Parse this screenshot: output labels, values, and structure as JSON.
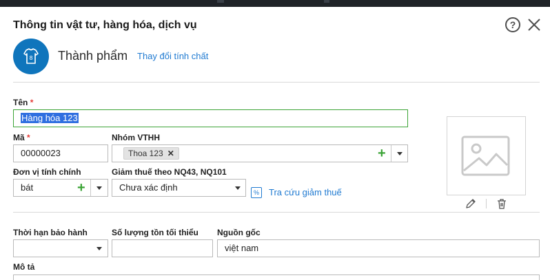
{
  "dialog": {
    "title": "Thông tin vật tư, hàng hóa, dịch vụ",
    "help_icon": "question-circle-icon",
    "close_icon": "close-icon"
  },
  "item_type": {
    "icon": "tshirt-icon",
    "label": "Thành phẩm",
    "change_link": "Thay đổi tính chất"
  },
  "form": {
    "name": {
      "label": "Tên",
      "required_mark": "*",
      "value": "Hàng hóa 123"
    },
    "code": {
      "label": "Mã",
      "required_mark": "*",
      "value": "00000023"
    },
    "group": {
      "label": "Nhóm VTHH",
      "tags": [
        "Thoa 123"
      ],
      "tag_remove": "✕"
    },
    "unit": {
      "label": "Đơn vị tính chính",
      "value": "bát"
    },
    "tax_reduction": {
      "label": "Giảm thuế theo NQ43, NQ101",
      "value": "Chưa xác định",
      "lookup_link": "Tra cứu giảm thuế",
      "lookup_icon": "percent-document-icon"
    },
    "warranty": {
      "label": "Thời hạn bảo hành",
      "value": ""
    },
    "min_stock": {
      "label": "Số lượng tồn tối thiểu",
      "value": ""
    },
    "origin": {
      "label": "Nguồn gốc",
      "value": "việt nam"
    },
    "description": {
      "label": "Mô tả"
    }
  },
  "image_panel": {
    "placeholder_icon": "image-placeholder-icon",
    "edit_icon": "pencil-icon",
    "delete_icon": "trash-icon"
  },
  "colors": {
    "accent_blue": "#0f75bc",
    "link_blue": "#1f7ad1",
    "active_green": "#3aa335",
    "required_red": "#e53935"
  }
}
